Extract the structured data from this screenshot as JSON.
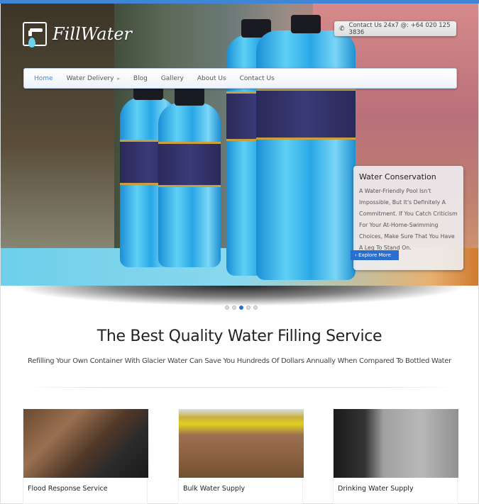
{
  "brand": {
    "name": "FillWater",
    "logo_icon": "water-tap-icon"
  },
  "contact": {
    "icon": "phone-icon",
    "text": "Contact Us 24x7 @: +64 020 125 3836"
  },
  "nav": {
    "items": [
      {
        "label": "Home",
        "active": true
      },
      {
        "label": "Water Delivery",
        "has_submenu": true
      },
      {
        "label": "Blog"
      },
      {
        "label": "Gallery"
      },
      {
        "label": "About Us"
      },
      {
        "label": "Contact Us"
      }
    ]
  },
  "slider": {
    "caption_title": "Water Conservation",
    "caption_text": "A Water-Friendly Pool Isn't Impossible, But It's Definitely A Commitment. If You Catch Criticism For Your At-Home-Swimming Choices, Make Sure That You Have A Leg To Stand On.",
    "button_label": "› Explore More",
    "slide_count": 5,
    "active_slide": 3
  },
  "intro": {
    "headline": "The Best Quality Water Filling Service",
    "subline": "Refilling Your Own Container With Glacier Water Can Save You Hundreds Of Dollars Annually When Compared To Bottled Water"
  },
  "services": [
    {
      "title": "Flood Response Service"
    },
    {
      "title": "Bulk Water Supply"
    },
    {
      "title": "Drinking Water Supply"
    }
  ],
  "colors": {
    "accent": "#2a6fcf",
    "topbar": "#3f86d6",
    "nav_active": "#4a8ad4"
  }
}
